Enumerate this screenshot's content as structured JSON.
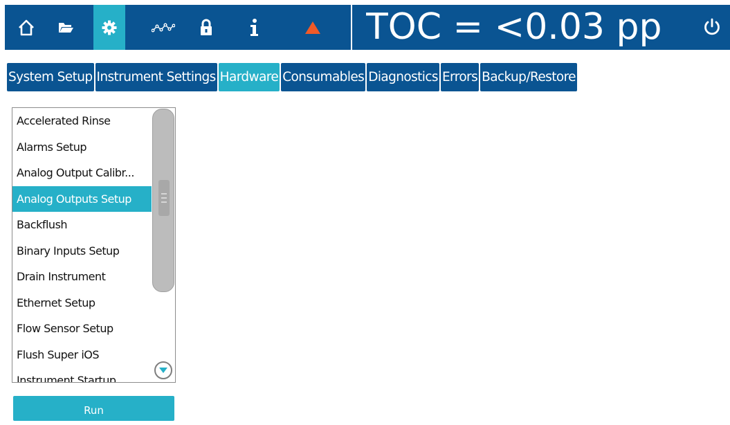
{
  "header": {
    "toc_readout": "TOC = <0.03 pp",
    "nav_icons": [
      "home-icon",
      "folder-icon",
      "gear-icon",
      "trend-icon",
      "lock-icon",
      "info-icon",
      "alarm-triangle-icon"
    ],
    "active_icon": "gear-icon",
    "power_icon": "power-icon"
  },
  "tabs": [
    {
      "label": "System Setup",
      "active": false
    },
    {
      "label": "Instrument Settings",
      "active": false
    },
    {
      "label": "Hardware",
      "active": true
    },
    {
      "label": "Consumables",
      "active": false
    },
    {
      "label": "Diagnostics",
      "active": false
    },
    {
      "label": "Errors",
      "active": false
    },
    {
      "label": "Backup/Restore",
      "active": false
    }
  ],
  "list": {
    "items": [
      "Accelerated Rinse",
      "Alarms Setup",
      "Analog Output Calibr...",
      "Analog Outputs Setup",
      "Backflush",
      "Binary Inputs Setup",
      "Drain Instrument",
      "Ethernet Setup",
      "Flow Sensor Setup",
      "Flush Super iOS",
      "Instrument Startup"
    ],
    "selected": "Analog Outputs Setup"
  },
  "run_label": "Run",
  "colors": {
    "header_bg": "#0a5492",
    "accent": "#26b0c8",
    "alarm": "#f05a28"
  }
}
